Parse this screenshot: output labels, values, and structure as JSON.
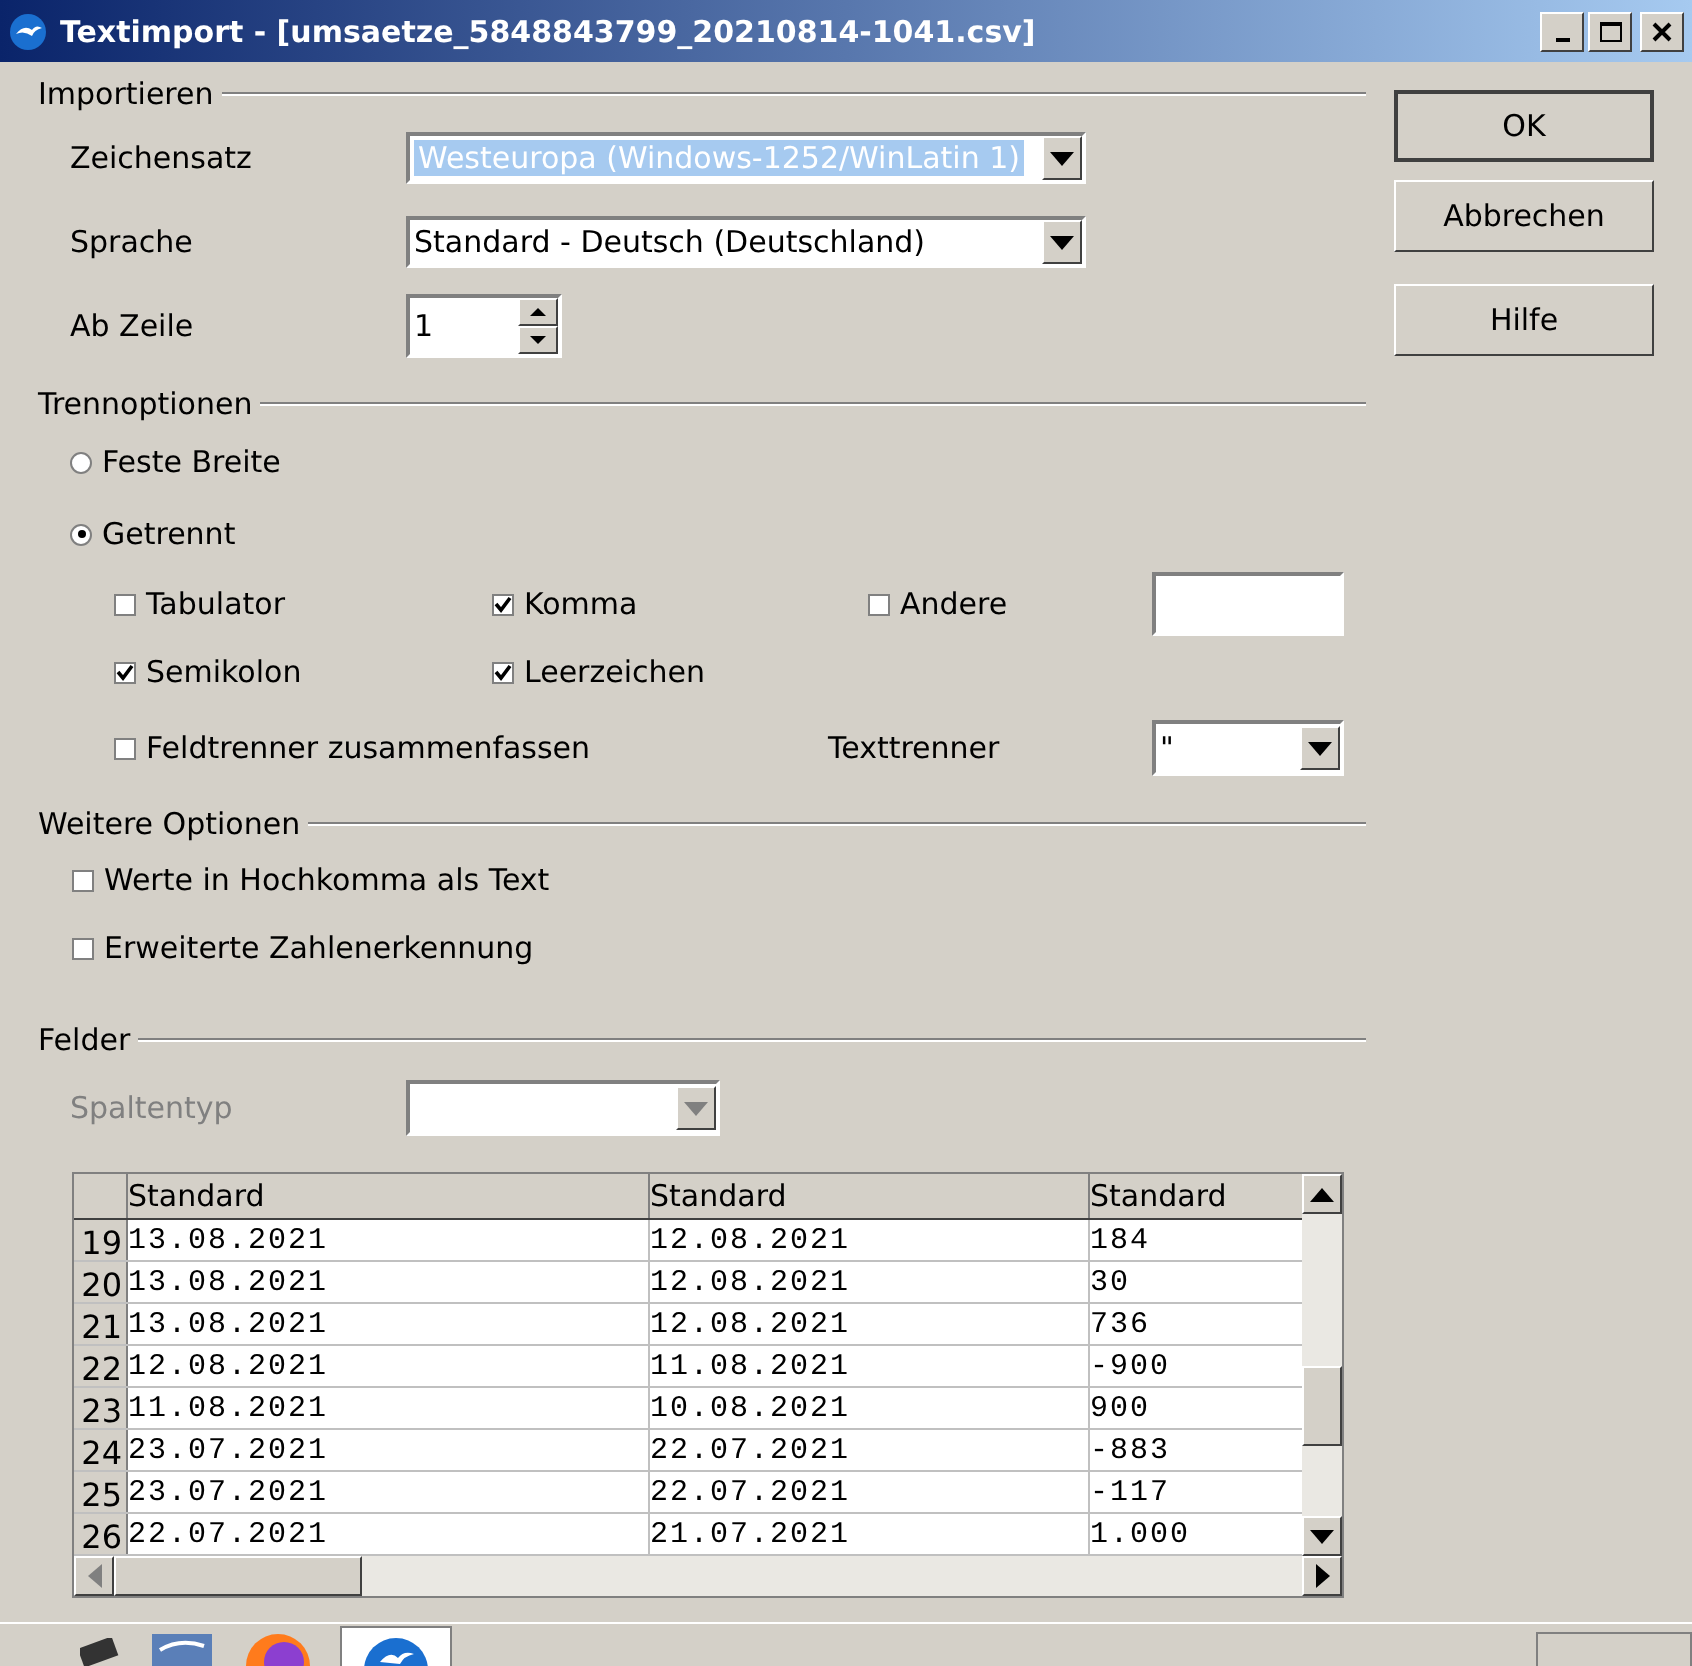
{
  "window": {
    "title": "Textimport - [umsaetze_5848843799_20210814-1041.csv]"
  },
  "import": {
    "heading": "Importieren",
    "fields": [
      {
        "kind": "combo",
        "label": "Zeichensatz",
        "value": "Westeuropa (Windows-1252/WinLatin 1)",
        "highlighted": true
      },
      {
        "kind": "combo",
        "label": "Sprache",
        "value": "Standard - Deutsch (Deutschland)",
        "highlighted": false
      },
      {
        "kind": "spin",
        "label": "Ab Zeile",
        "value": "1",
        "highlighted": false
      }
    ]
  },
  "separator_options": {
    "heading": "Trennoptionen",
    "modes": [
      {
        "label": "Feste Breite",
        "selected": false
      },
      {
        "label": "Getrennt",
        "selected": true
      }
    ],
    "separators": [
      {
        "kind": "check",
        "label": "Tabulator",
        "checked": false
      },
      {
        "kind": "check",
        "label": "Komma",
        "checked": true
      },
      {
        "kind": "check_with_field",
        "label": "Andere",
        "checked": false
      },
      {
        "kind": "check",
        "label": "Semikolon",
        "checked": true
      },
      {
        "kind": "check",
        "label": "Leerzeichen",
        "checked": true
      }
    ],
    "merge": {
      "label": "Feldtrenner zusammenfassen",
      "checked": false
    },
    "text_delimiter": {
      "label": "Texttrenner",
      "value": "\""
    }
  },
  "other_options": {
    "heading": "Weitere Optionen",
    "options": [
      {
        "label": "Werte in Hochkomma als Text",
        "checked": false
      },
      {
        "label": "Erweiterte Zahlenerkennung",
        "checked": false
      }
    ]
  },
  "fields": {
    "heading": "Felder",
    "column_type": {
      "label": "Spaltentyp",
      "disabled": true
    },
    "table": {
      "columns": [
        "Standard",
        "Standard",
        "Standard"
      ],
      "rows": [
        {
          "number": "19",
          "cells": [
            "13.08.2021",
            "12.08.2021",
            "184"
          ]
        },
        {
          "number": "20",
          "cells": [
            "13.08.2021",
            "12.08.2021",
            "30"
          ]
        },
        {
          "number": "21",
          "cells": [
            "13.08.2021",
            "12.08.2021",
            "736"
          ]
        },
        {
          "number": "22",
          "cells": [
            "12.08.2021",
            "11.08.2021",
            "-900"
          ]
        },
        {
          "number": "23",
          "cells": [
            "11.08.2021",
            "10.08.2021",
            "900"
          ]
        },
        {
          "number": "24",
          "cells": [
            "23.07.2021",
            "22.07.2021",
            "-883"
          ]
        },
        {
          "number": "25",
          "cells": [
            "23.07.2021",
            "22.07.2021",
            "-117"
          ]
        },
        {
          "number": "26",
          "cells": [
            "22.07.2021",
            "21.07.2021",
            "1.000"
          ]
        }
      ]
    }
  },
  "buttons": [
    {
      "label": "OK",
      "default": true
    },
    {
      "label": "Abbrechen",
      "default": false
    },
    {
      "label": "Hilfe",
      "default": false
    }
  ]
}
